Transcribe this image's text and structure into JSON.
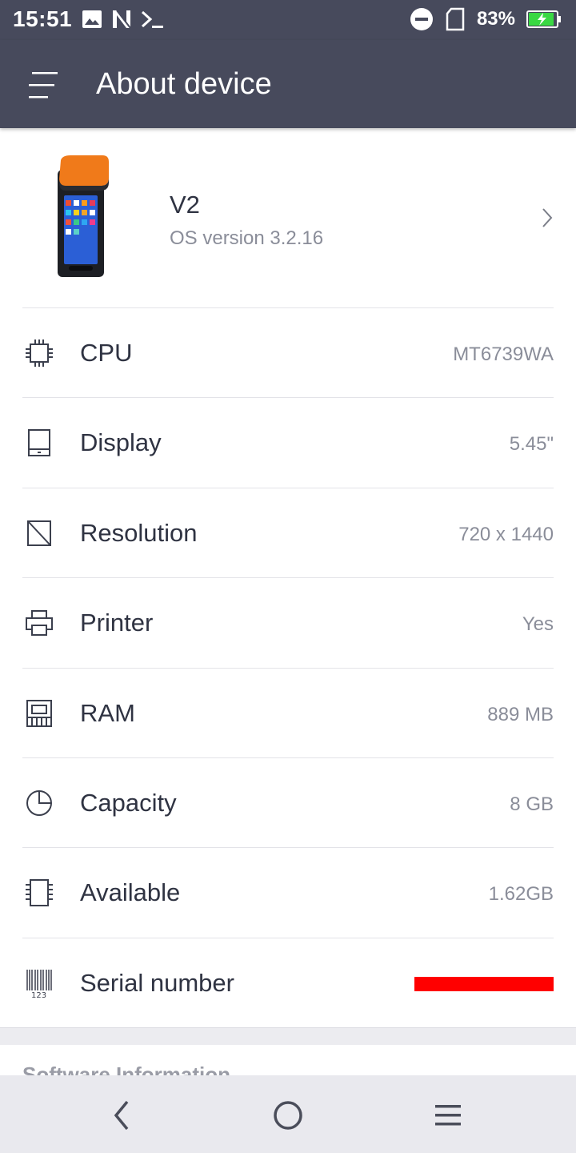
{
  "status_bar": {
    "time": "15:51",
    "battery_percent": "83%",
    "icons": [
      "image-icon",
      "n-icon",
      "terminal-icon",
      "dnd-icon",
      "sim-icon",
      "battery-charging-icon"
    ]
  },
  "app_bar": {
    "title": "About device",
    "background": "#474a5c"
  },
  "device": {
    "name": "V2",
    "os_version": "OS version 3.2.16"
  },
  "specs": [
    {
      "icon": "cpu-icon",
      "label": "CPU",
      "value": "MT6739WA"
    },
    {
      "icon": "display-icon",
      "label": "Display",
      "value": "5.45\""
    },
    {
      "icon": "resolution-icon",
      "label": "Resolution",
      "value": "720 x 1440"
    },
    {
      "icon": "printer-icon",
      "label": "Printer",
      "value": "Yes"
    },
    {
      "icon": "ram-icon",
      "label": "RAM",
      "value": "889 MB"
    },
    {
      "icon": "capacity-pie-icon",
      "label": "Capacity",
      "value": "8 GB"
    },
    {
      "icon": "storage-chip-icon",
      "label": "Available",
      "value": "1.62GB"
    },
    {
      "icon": "barcode-icon",
      "label": "Serial number",
      "value": ""
    }
  ],
  "software_section": {
    "title": "Software Information"
  },
  "nav_bar": {
    "buttons": [
      "back-icon",
      "home-icon",
      "menu-lines-icon"
    ]
  }
}
